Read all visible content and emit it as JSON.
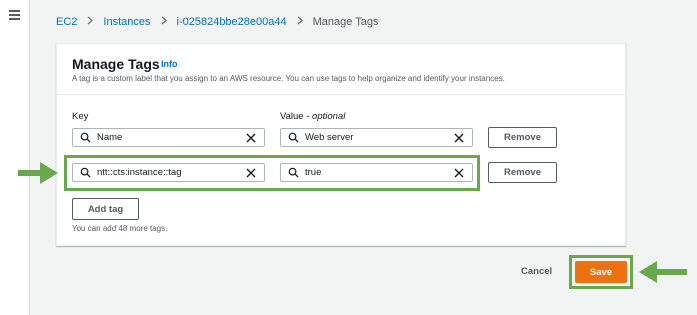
{
  "breadcrumb": {
    "items": [
      "EC2",
      "Instances",
      "i-025824bbe28e00a44"
    ],
    "current": "Manage Tags"
  },
  "card": {
    "title": "Manage Tags",
    "info_label": "Info",
    "description": "A tag is a custom label that you assign to an AWS resource. You can use tags to help organize and identify your instances."
  },
  "columns": {
    "key_label": "Key",
    "value_label": "Value",
    "value_optional": " - optional"
  },
  "tags": [
    {
      "key": "Name",
      "value": "Web server",
      "remove_label": "Remove"
    },
    {
      "key": "ntt::cts:instance::tag",
      "value": "true",
      "remove_label": "Remove"
    }
  ],
  "add_tag_label": "Add tag",
  "helper_text": "You can add 48 more tags.",
  "footer": {
    "cancel_label": "Cancel",
    "save_label": "Save"
  },
  "colors": {
    "link": "#0073bb",
    "primary": "#ec7211",
    "annotation": "#6aa84f",
    "border": "#aab7b8"
  },
  "icons": [
    "menu-icon",
    "chevron-right-icon",
    "search-icon",
    "clear-icon",
    "arrow-right-icon",
    "arrow-left-icon"
  ]
}
